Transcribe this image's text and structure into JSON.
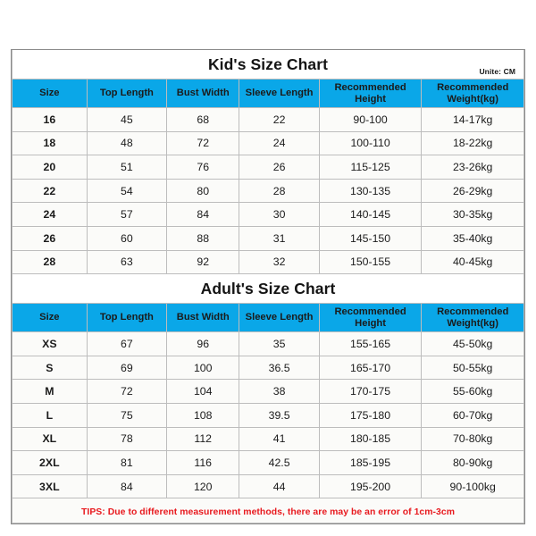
{
  "unit_note": "Unite: CM",
  "accent_color": "#0aa7e8",
  "tips_color": "#e8191e",
  "columns": [
    {
      "line1": "Size",
      "line2": ""
    },
    {
      "line1": "Top Length",
      "line2": ""
    },
    {
      "line1": "Bust Width",
      "line2": ""
    },
    {
      "line1": "Sleeve Length",
      "line2": ""
    },
    {
      "line1": "Recommended",
      "line2": "Height"
    },
    {
      "line1": "Recommended",
      "line2": "Weight(kg)"
    }
  ],
  "kids": {
    "title": "Kid's Size Chart",
    "rows": [
      {
        "size": "16",
        "top_length": "45",
        "bust_width": "68",
        "sleeve_length": "22",
        "height": "90-100",
        "weight": "14-17kg"
      },
      {
        "size": "18",
        "top_length": "48",
        "bust_width": "72",
        "sleeve_length": "24",
        "height": "100-110",
        "weight": "18-22kg"
      },
      {
        "size": "20",
        "top_length": "51",
        "bust_width": "76",
        "sleeve_length": "26",
        "height": "115-125",
        "weight": "23-26kg"
      },
      {
        "size": "22",
        "top_length": "54",
        "bust_width": "80",
        "sleeve_length": "28",
        "height": "130-135",
        "weight": "26-29kg"
      },
      {
        "size": "24",
        "top_length": "57",
        "bust_width": "84",
        "sleeve_length": "30",
        "height": "140-145",
        "weight": "30-35kg"
      },
      {
        "size": "26",
        "top_length": "60",
        "bust_width": "88",
        "sleeve_length": "31",
        "height": "145-150",
        "weight": "35-40kg"
      },
      {
        "size": "28",
        "top_length": "63",
        "bust_width": "92",
        "sleeve_length": "32",
        "height": "150-155",
        "weight": "40-45kg"
      }
    ]
  },
  "adults": {
    "title": "Adult's Size Chart",
    "rows": [
      {
        "size": "XS",
        "top_length": "67",
        "bust_width": "96",
        "sleeve_length": "35",
        "height": "155-165",
        "weight": "45-50kg"
      },
      {
        "size": "S",
        "top_length": "69",
        "bust_width": "100",
        "sleeve_length": "36.5",
        "height": "165-170",
        "weight": "50-55kg"
      },
      {
        "size": "M",
        "top_length": "72",
        "bust_width": "104",
        "sleeve_length": "38",
        "height": "170-175",
        "weight": "55-60kg"
      },
      {
        "size": "L",
        "top_length": "75",
        "bust_width": "108",
        "sleeve_length": "39.5",
        "height": "175-180",
        "weight": "60-70kg"
      },
      {
        "size": "XL",
        "top_length": "78",
        "bust_width": "112",
        "sleeve_length": "41",
        "height": "180-185",
        "weight": "70-80kg"
      },
      {
        "size": "2XL",
        "top_length": "81",
        "bust_width": "116",
        "sleeve_length": "42.5",
        "height": "185-195",
        "weight": "80-90kg"
      },
      {
        "size": "3XL",
        "top_length": "84",
        "bust_width": "120",
        "sleeve_length": "44",
        "height": "195-200",
        "weight": "90-100kg"
      }
    ]
  },
  "tips": "TIPS: Due to different measurement methods, there are may be an error of 1cm-3cm",
  "chart_data": {
    "type": "table",
    "title": "Kid's and Adult's Size Chart",
    "unit": "CM",
    "columns": [
      "Size",
      "Top Length",
      "Bust Width",
      "Sleeve Length",
      "Recommended Height",
      "Recommended Weight(kg)"
    ],
    "tables": [
      {
        "title": "Kid's Size Chart",
        "rows": [
          [
            "16",
            "45",
            "68",
            "22",
            "90-100",
            "14-17kg"
          ],
          [
            "18",
            "48",
            "72",
            "24",
            "100-110",
            "18-22kg"
          ],
          [
            "20",
            "51",
            "76",
            "26",
            "115-125",
            "23-26kg"
          ],
          [
            "22",
            "54",
            "80",
            "28",
            "130-135",
            "26-29kg"
          ],
          [
            "24",
            "57",
            "84",
            "30",
            "140-145",
            "30-35kg"
          ],
          [
            "26",
            "60",
            "88",
            "31",
            "145-150",
            "35-40kg"
          ],
          [
            "28",
            "63",
            "92",
            "32",
            "150-155",
            "40-45kg"
          ]
        ]
      },
      {
        "title": "Adult's Size Chart",
        "rows": [
          [
            "XS",
            "67",
            "96",
            "35",
            "155-165",
            "45-50kg"
          ],
          [
            "S",
            "69",
            "100",
            "36.5",
            "165-170",
            "50-55kg"
          ],
          [
            "M",
            "72",
            "104",
            "38",
            "170-175",
            "55-60kg"
          ],
          [
            "L",
            "75",
            "108",
            "39.5",
            "175-180",
            "60-70kg"
          ],
          [
            "XL",
            "78",
            "112",
            "41",
            "180-185",
            "70-80kg"
          ],
          [
            "2XL",
            "81",
            "116",
            "42.5",
            "185-195",
            "80-90kg"
          ],
          [
            "3XL",
            "84",
            "120",
            "44",
            "195-200",
            "90-100kg"
          ]
        ]
      }
    ],
    "footnote": "TIPS: Due to different measurement methods, there are may be an error of 1cm-3cm"
  }
}
